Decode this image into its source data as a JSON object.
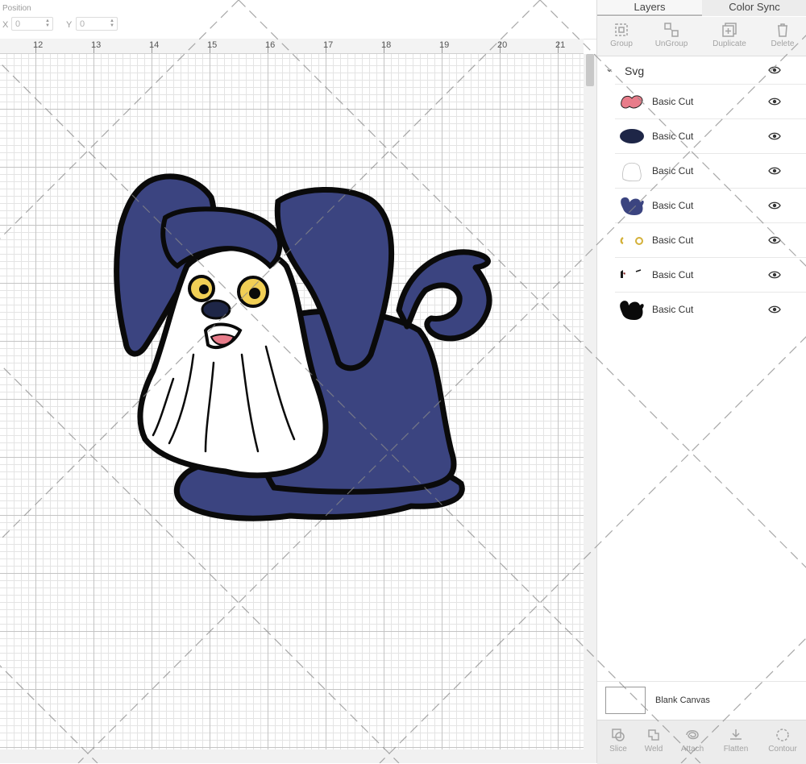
{
  "position": {
    "label": "Position",
    "x_label": "X",
    "x_value": "0",
    "y_label": "Y",
    "y_value": "0"
  },
  "ruler": {
    "ticks": [
      "12",
      "13",
      "14",
      "15",
      "16",
      "17",
      "18",
      "19",
      "20",
      "21"
    ]
  },
  "panel": {
    "tabs": [
      {
        "label": "Layers"
      },
      {
        "label": "Color Sync"
      }
    ],
    "toolbar": {
      "group": "Group",
      "ungroup": "UnGroup",
      "duplicate": "Duplicate",
      "delete": "Delete"
    },
    "group_name": "Svg",
    "layers": [
      {
        "name": "Basic Cut",
        "icon": "pink-shape-thumbnail"
      },
      {
        "name": "Basic Cut",
        "icon": "navy-oval-thumbnail"
      },
      {
        "name": "Basic Cut",
        "icon": "white-shape-thumbnail"
      },
      {
        "name": "Basic Cut",
        "icon": "blue-dog-thumbnail"
      },
      {
        "name": "Basic Cut",
        "icon": "yellow-eyes-thumbnail"
      },
      {
        "name": "Basic Cut",
        "icon": "dark-marks-thumbnail"
      },
      {
        "name": "Basic Cut",
        "icon": "black-silhouette-thumbnail"
      }
    ],
    "canvas_name": "Blank Canvas",
    "bottom": {
      "slice": "Slice",
      "weld": "Weld",
      "attach": "Attach",
      "flatten": "Flatten",
      "contour": "Contour"
    }
  },
  "colors": {
    "fur": "#3b4480",
    "fur_dark": "#2a2f55",
    "outline": "#0a0a0a",
    "white": "#ffffff",
    "eye": "#f1cf55",
    "tongue": "#e87c8a",
    "nose_layer": "#1e2647"
  }
}
